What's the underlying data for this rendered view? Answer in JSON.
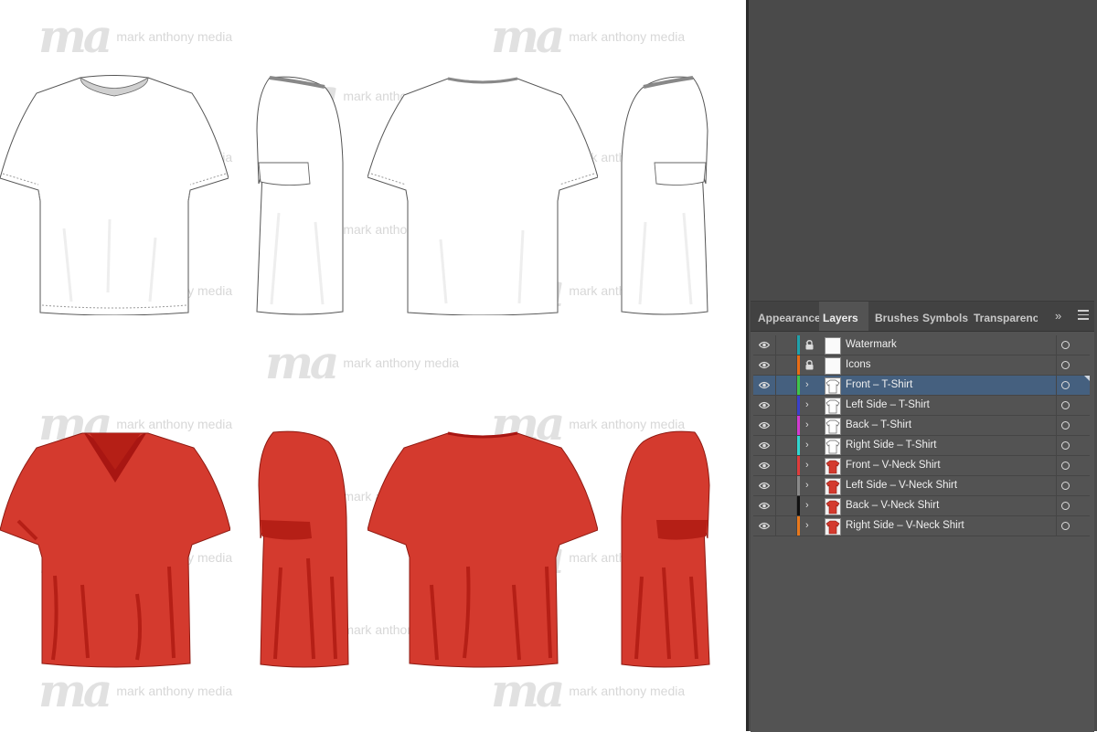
{
  "watermark": {
    "logo": "ma",
    "text": "mark anthony media"
  },
  "panel": {
    "tabs": [
      {
        "label": "Appearance",
        "active": false
      },
      {
        "label": "Layers",
        "active": true
      },
      {
        "label": "Brushes",
        "active": false
      },
      {
        "label": "Symbols",
        "active": false
      },
      {
        "label": "Transparency",
        "active": false
      }
    ],
    "more_icon": "double-chevron-icon",
    "menu_icon": "hamburger-menu-icon"
  },
  "layers": [
    {
      "name": "Watermark",
      "visible": true,
      "locked": true,
      "color": "#1fa1ab",
      "thumb": "blank"
    },
    {
      "name": "Icons",
      "visible": true,
      "locked": true,
      "color": "#e86c14",
      "thumb": "blank"
    },
    {
      "name": "Front – T-Shirt",
      "visible": true,
      "locked": false,
      "color": "#3ec44a",
      "thumb": "white",
      "selected": true
    },
    {
      "name": "Left Side – T-Shirt",
      "visible": true,
      "locked": false,
      "color": "#3a40c9",
      "thumb": "white"
    },
    {
      "name": "Back – T-Shirt",
      "visible": true,
      "locked": false,
      "color": "#d23ad1",
      "thumb": "white"
    },
    {
      "name": "Right Side – T-Shirt",
      "visible": true,
      "locked": false,
      "color": "#31d6d0",
      "thumb": "white"
    },
    {
      "name": "Front – V-Neck Shirt",
      "visible": true,
      "locked": false,
      "color": "#e03b3b",
      "thumb": "red"
    },
    {
      "name": "Left Side – V-Neck Shirt",
      "visible": true,
      "locked": false,
      "color": "#8a8a8a",
      "thumb": "red"
    },
    {
      "name": "Back – V-Neck Shirt",
      "visible": true,
      "locked": false,
      "color": "#111111",
      "thumb": "red"
    },
    {
      "name": "Right Side – V-Neck Shirt",
      "visible": true,
      "locked": false,
      "color": "#e8781c",
      "thumb": "red"
    }
  ],
  "colors": {
    "shirt_red": "#d43a2e",
    "shirt_red_shade": "#b51f16",
    "collar_red": "#a81612",
    "panel_bg": "#535353",
    "selected_row": "#45607f"
  }
}
